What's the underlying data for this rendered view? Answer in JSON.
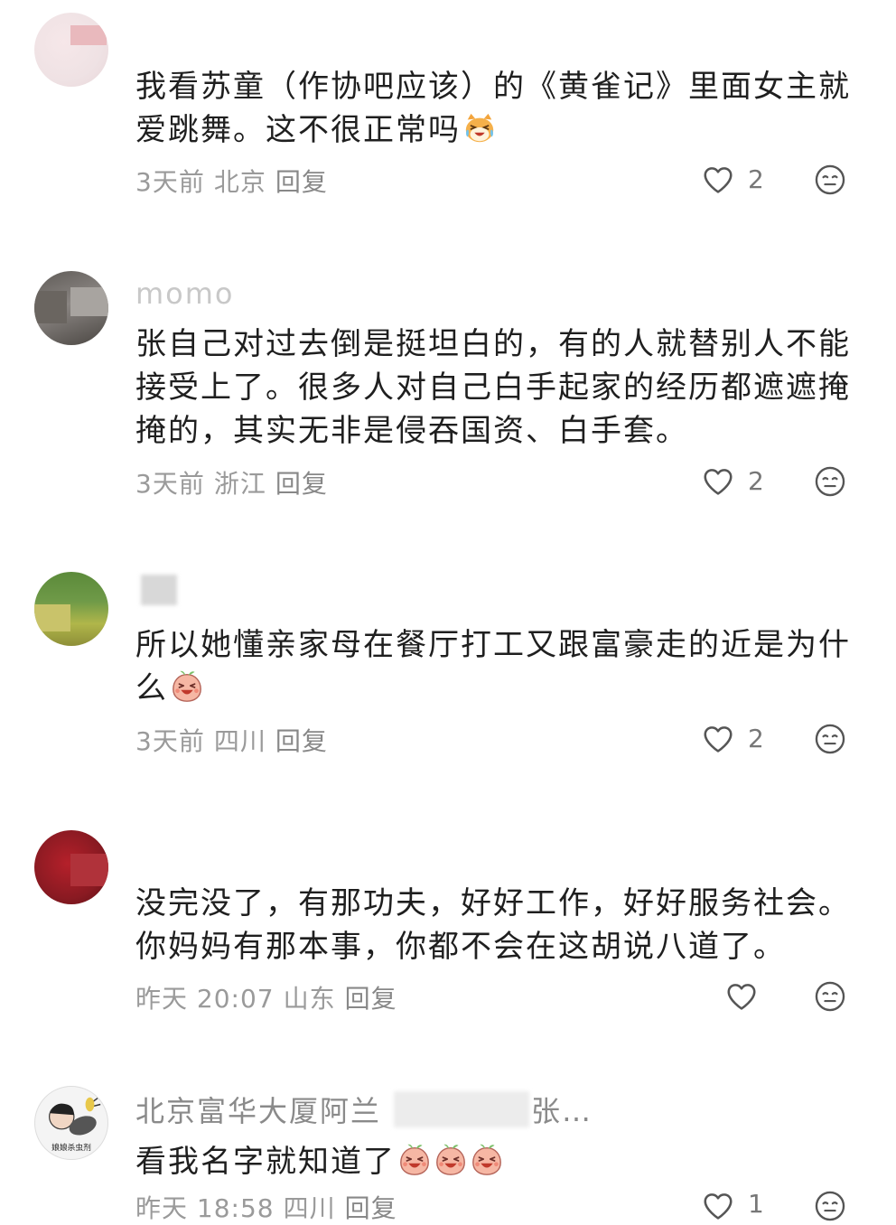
{
  "comments": [
    {
      "username": "",
      "text": "我看苏童（作协吧应该）的《黄雀记》里面女主就爱跳舞。这不很正常吗",
      "emoji": "laughing-cat",
      "time": "3天前",
      "location": "北京",
      "reply_label": "回复",
      "likes": "2"
    },
    {
      "username": "momo",
      "text": "张自己对过去倒是挺坦白的，有的人就替别人不能接受上了。很多人对自己白手起家的经历都遮遮掩掩的，其实无非是侵吞国资、白手套。",
      "time": "3天前",
      "location": "浙江",
      "reply_label": "回复",
      "likes": "2"
    },
    {
      "username": "",
      "text": "所以她懂亲家母在餐厅打工又跟富豪走的近是为什么",
      "emoji": "laughing-peach",
      "time": "3天前",
      "location": "四川",
      "reply_label": "回复",
      "likes": "2"
    },
    {
      "username": "",
      "text": "没完没了，有那功夫，好好工作，好好服务社会。你妈妈有那本事，你都不会在这胡说八道了。",
      "time": "昨天 20:07",
      "location": "山东",
      "reply_label": "回复",
      "likes": ""
    },
    {
      "username": "北京富华大厦阿兰",
      "username_tail": "张…",
      "text": "看我名字就知道了",
      "emoji": "laughing-peach",
      "emoji_count": 3,
      "time": "昨天 18:58",
      "location": "四川",
      "reply_label": "回复",
      "likes": "1",
      "avatar_caption": "娘娘杀虫剂"
    }
  ],
  "colors": {
    "text": "#1f1f1f",
    "meta": "#9a9a9a",
    "icon": "#555555"
  }
}
